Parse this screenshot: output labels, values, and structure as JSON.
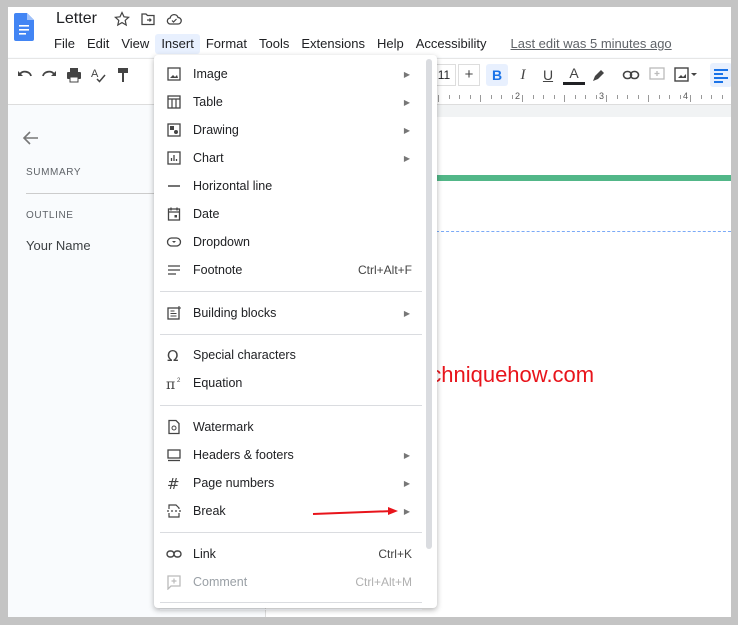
{
  "doc": {
    "title": "Letter",
    "last_edit": "Last edit was 5 minutes ago"
  },
  "menubar": [
    "File",
    "Edit",
    "View",
    "Insert",
    "Format",
    "Tools",
    "Extensions",
    "Help",
    "Accessibility"
  ],
  "toolbar": {
    "font_size": "11"
  },
  "ruler": [
    "2",
    "3",
    "4"
  ],
  "outline": {
    "summary": "SUMMARY",
    "outline": "OUTLINE",
    "heading": "Your Name"
  },
  "insert_menu": {
    "items": [
      {
        "label": "Image",
        "icon": "image-icon",
        "submenu": true
      },
      {
        "label": "Table",
        "icon": "table-icon",
        "submenu": true
      },
      {
        "label": "Drawing",
        "icon": "drawing-icon",
        "submenu": true
      },
      {
        "label": "Chart",
        "icon": "chart-icon",
        "submenu": true
      },
      {
        "label": "Horizontal line",
        "icon": "horizontal-line-icon"
      },
      {
        "label": "Date",
        "icon": "calendar-icon"
      },
      {
        "label": "Dropdown",
        "icon": "dropdown-icon"
      },
      {
        "label": "Footnote",
        "icon": "footnote-icon",
        "shortcut": "Ctrl+Alt+F"
      },
      {
        "label": "Building blocks",
        "icon": "building-blocks-icon",
        "submenu": true
      },
      {
        "label": "Special characters",
        "icon": "omega-icon"
      },
      {
        "label": "Equation",
        "icon": "pi-icon"
      },
      {
        "label": "Watermark",
        "icon": "watermark-icon"
      },
      {
        "label": "Headers & footers",
        "icon": "headers-footers-icon",
        "submenu": true
      },
      {
        "label": "Page numbers",
        "icon": "hash-icon",
        "submenu": true
      },
      {
        "label": "Break",
        "icon": "break-icon",
        "submenu": true
      },
      {
        "label": "Link",
        "icon": "link-icon",
        "shortcut": "Ctrl+K"
      },
      {
        "label": "Comment",
        "icon": "comment-icon",
        "shortcut": "Ctrl+Alt+M",
        "disabled": true
      }
    ]
  },
  "watermark_text": "Techniquehow.com",
  "colors": {
    "accent": "#1a73e8",
    "green_rule": "#52b788",
    "annotation": "#e8141b"
  }
}
